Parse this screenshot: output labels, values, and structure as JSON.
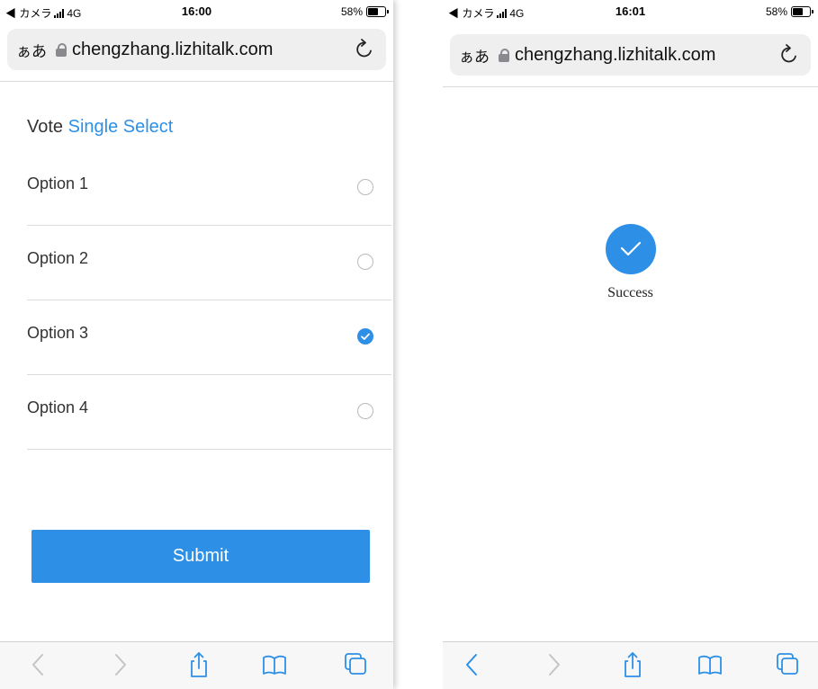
{
  "left_screen": {
    "status": {
      "carrier": "◀ カメラ",
      "network": "4G",
      "time": "16:00",
      "battery": "58%"
    },
    "browser": {
      "aa_label": "ぁあ",
      "url": "chengzhang.lizhitalk.com"
    },
    "vote": {
      "title_prefix": "Vote",
      "title_kind": "Single Select",
      "options": [
        {
          "label": "Option 1",
          "selected": false
        },
        {
          "label": "Option 2",
          "selected": false
        },
        {
          "label": "Option 3",
          "selected": true
        },
        {
          "label": "Option 4",
          "selected": false
        }
      ],
      "submit_label": "Submit"
    },
    "toolbar": {
      "back_enabled": false,
      "forward_enabled": false
    }
  },
  "right_screen": {
    "status": {
      "carrier": "◀ カメラ",
      "network": "4G",
      "time": "16:01",
      "battery": "58%"
    },
    "browser": {
      "aa_label": "ぁあ",
      "url": "chengzhang.lizhitalk.com"
    },
    "result": {
      "icon": "checkmark-icon",
      "message": "Success"
    },
    "toolbar": {
      "back_enabled": true,
      "forward_enabled": false
    }
  },
  "colors": {
    "accent": "#2d8fe6",
    "toolbar_enabled": "#2d8fe6",
    "toolbar_disabled": "#c4c4c8"
  }
}
